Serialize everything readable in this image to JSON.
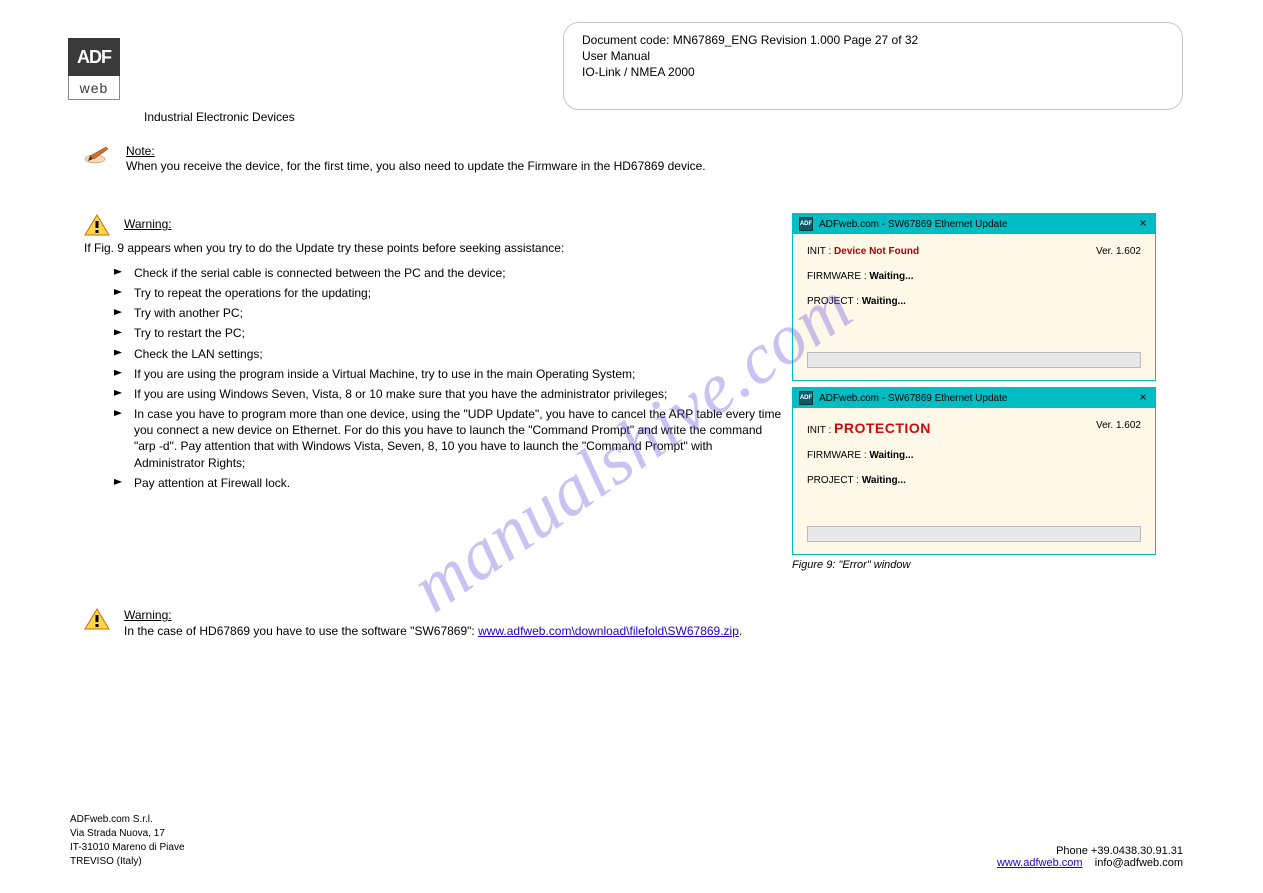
{
  "logo": {
    "top": "ADF",
    "bot": "web"
  },
  "header": {
    "docnum": "Document code: MN67869_ENG  Revision 1.000  Page 27 of 32",
    "title": "User Manual",
    "subtitle": "IO-Link / NMEA 2000"
  },
  "subhead": "Industrial Electronic Devices",
  "note": {
    "label": "Note:",
    "body": "When you receive the device, for the first time, you also need to update the Firmware in the HD67869 device."
  },
  "warn1": {
    "label": "Warning:",
    "lead": "If Fig. 9 appears when you try to do the Update try these points before seeking assistance:",
    "items": [
      "Check if the serial cable is connected between the PC and the device;",
      "Try to repeat the operations for the updating;",
      "Try with another PC;",
      "Try to restart the PC;",
      "Check the LAN settings;",
      "If you are using the program inside a Virtual Machine, try to use in the main Operating System;",
      "If you are using Windows Seven, Vista, 8 or 10 make sure that you have the administrator privileges;",
      "In case you have to program more than one device, using the \"UDP Update\", you have to cancel the ARP table every time you connect a new device on Ethernet. For do this you have to launch the \"Command Prompt\" and write the command \"arp -d\". Pay attention that with Windows Vista, Seven, 8, 10 you have to launch the \"Command Prompt\" with Administrator Rights;",
      "Pay attention at Firewall lock."
    ]
  },
  "warn2": {
    "label": "Warning:",
    "body_pre": "In the case of HD67869 you have to use the software \"SW67869\": ",
    "link": "www.adfweb.com\\download\\filefold\\SW67869.zip",
    "body_post": "."
  },
  "win1": {
    "title": "ADFweb.com - SW67869 Ethernet Update",
    "ver": "Ver. 1.602",
    "init_k": "INIT :",
    "init_v": "Device Not Found",
    "fw_k": "FIRMWARE :",
    "fw_v": "Waiting...",
    "pj_k": "PROJECT :",
    "pj_v": "Waiting..."
  },
  "win2": {
    "title": "ADFweb.com - SW67869 Ethernet Update",
    "ver": "Ver. 1.602",
    "init_k": "INIT :",
    "init_v": "PROTECTION",
    "fw_k": "FIRMWARE :",
    "fw_v": "Waiting...",
    "pj_k": "PROJECT :",
    "pj_v": "Waiting..."
  },
  "figcap": "Figure 9: \"Error\" window",
  "watermark": "manualshive.com",
  "footer": {
    "left_l1": "ADFweb.com  S.r.l.",
    "left_l2": "Via Strada Nuova, 17",
    "left_l3": "IT-31010 Mareno di Piave",
    "left_l4": "TREVISO (Italy)",
    "right_l1": "Phone +39.0438.30.91.31",
    "right_url": "www.adfweb.com",
    "right_email": "info@adfweb.com"
  }
}
